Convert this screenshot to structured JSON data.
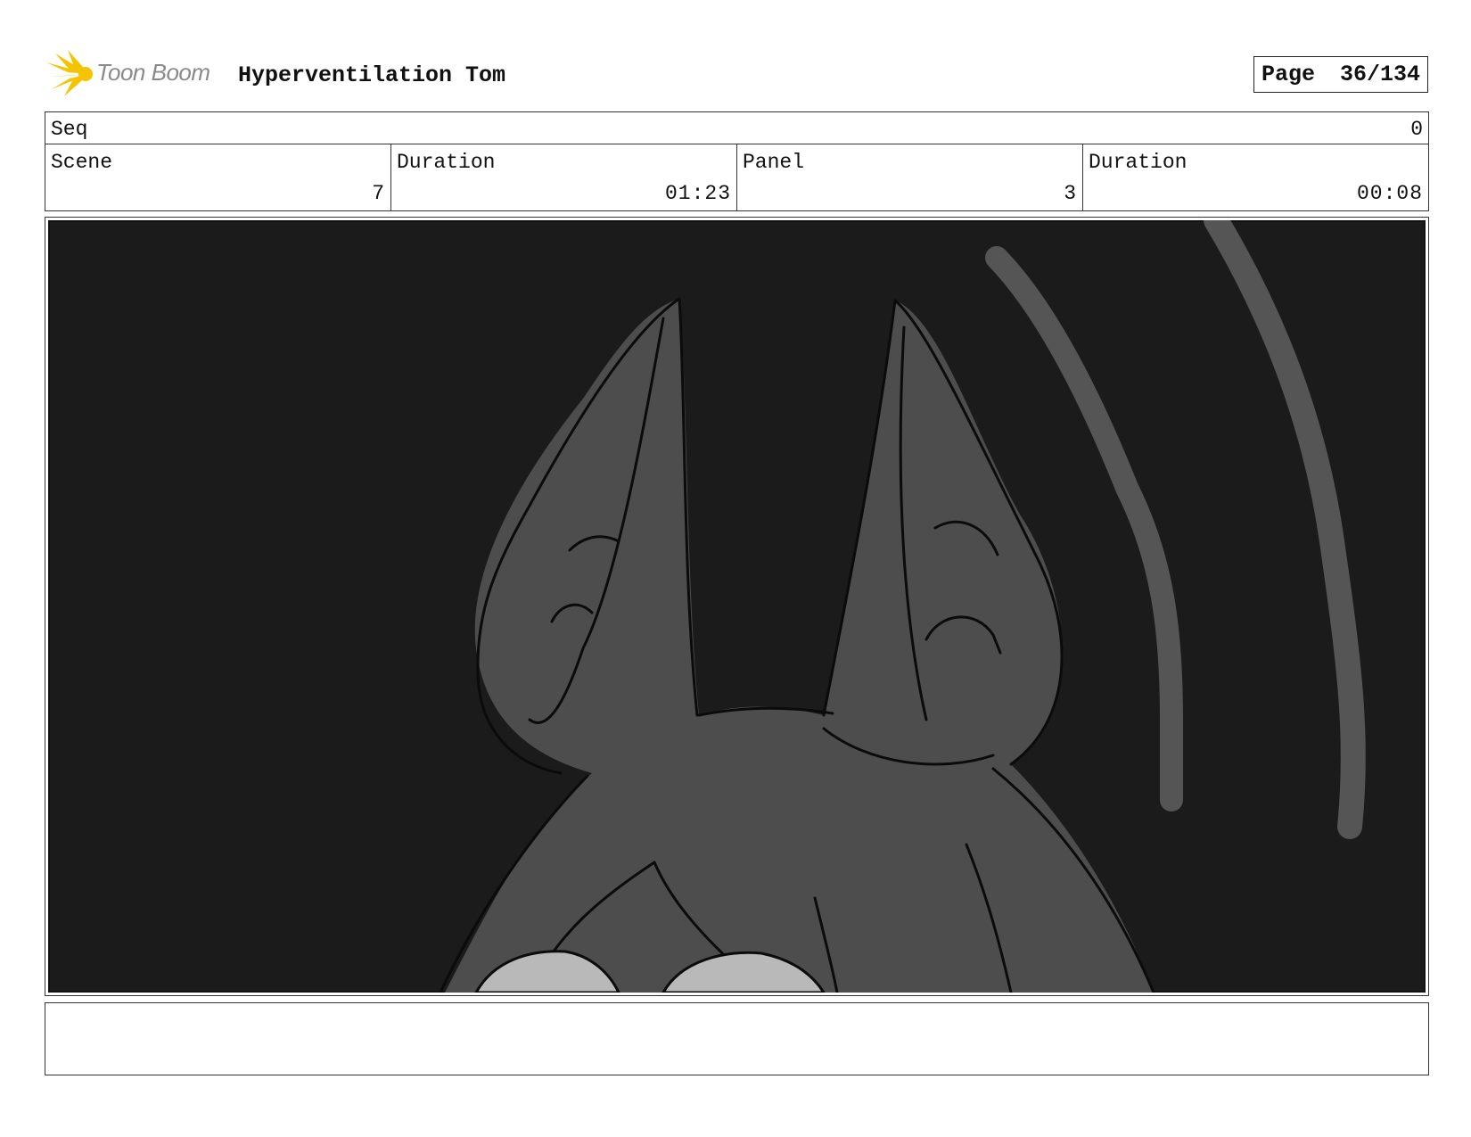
{
  "header": {
    "logo_text": "Toon Boom",
    "project_title": "Hyperventilation Tom",
    "page_label": "Page",
    "page_value": "36/134"
  },
  "seq": {
    "label": "Seq",
    "value": "0"
  },
  "info": {
    "scene_label": "Scene",
    "scene_value": "7",
    "scene_duration_label": "Duration",
    "scene_duration_value": "01:23",
    "panel_label": "Panel",
    "panel_value": "3",
    "panel_duration_label": "Duration",
    "panel_duration_value": "00:08"
  },
  "notes": {
    "text": ""
  },
  "colors": {
    "panel_bg": "#1b1b1b",
    "figure_fill": "#4d4d4d",
    "motion_lines": "#555555",
    "eyes": "#b9b9b9",
    "logo_yellow": "#f5c400"
  }
}
